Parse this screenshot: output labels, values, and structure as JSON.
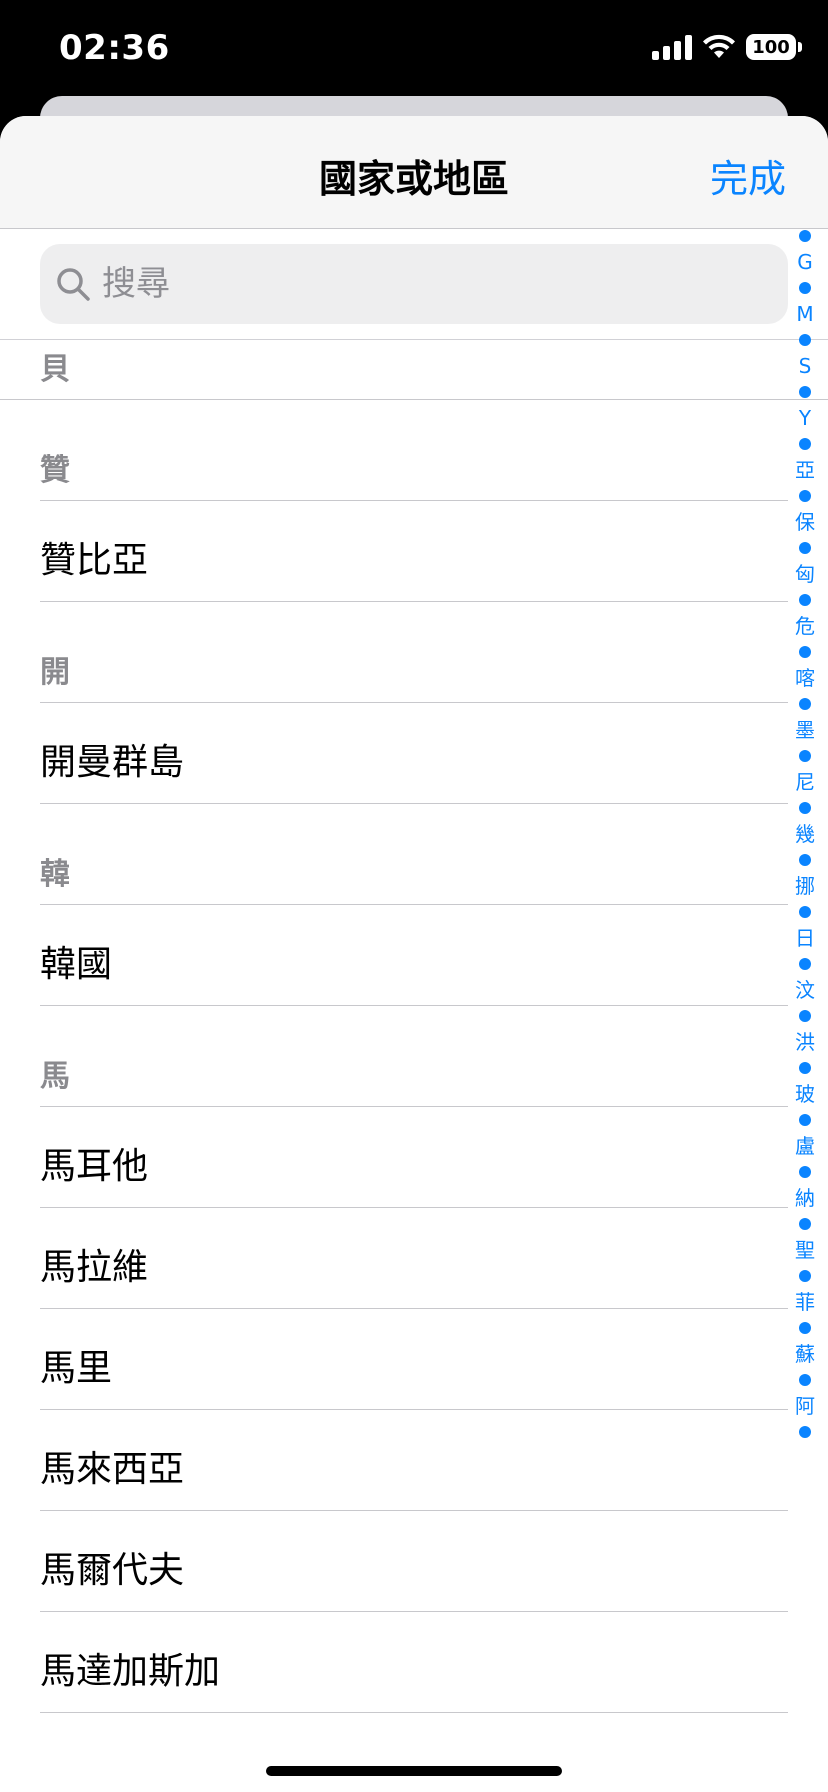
{
  "status_bar": {
    "time": "02:36",
    "battery": "100"
  },
  "sheet": {
    "title": "國家或地區",
    "done_label": "完成"
  },
  "search": {
    "placeholder": "搜尋",
    "value": ""
  },
  "list": [
    {
      "type": "header",
      "label": "貝",
      "first": true
    },
    {
      "type": "header",
      "label": "贊"
    },
    {
      "type": "item",
      "label": "贊比亞"
    },
    {
      "type": "header",
      "label": "開"
    },
    {
      "type": "item",
      "label": "開曼群島"
    },
    {
      "type": "header",
      "label": "韓"
    },
    {
      "type": "item",
      "label": "韓國"
    },
    {
      "type": "header",
      "label": "馬"
    },
    {
      "type": "item",
      "label": "馬耳他"
    },
    {
      "type": "item",
      "label": "馬拉維"
    },
    {
      "type": "item",
      "label": "馬里"
    },
    {
      "type": "item",
      "label": "馬來西亞"
    },
    {
      "type": "item",
      "label": "馬爾代夫"
    },
    {
      "type": "item",
      "label": "馬達加斯加"
    }
  ],
  "index": [
    "G",
    "M",
    "S",
    "Y",
    "亞",
    "保",
    "匈",
    "危",
    "喀",
    "墨",
    "尼",
    "幾",
    "挪",
    "日",
    "汶",
    "洪",
    "玻",
    "盧",
    "納",
    "聖",
    "菲",
    "蘇",
    "阿"
  ],
  "colors": {
    "accent": "#0a84ff",
    "section_text": "#8a8a8e"
  }
}
